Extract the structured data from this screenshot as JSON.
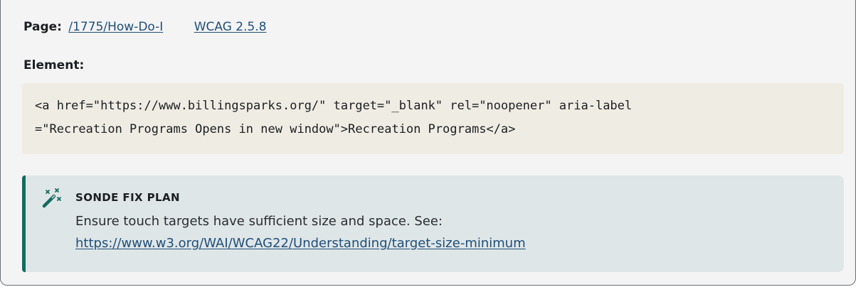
{
  "issue": {
    "page_label": "Page:",
    "page_link": "/1775/How-Do-I",
    "wcag_link": "WCAG 2.5.8",
    "element_label": "Element:",
    "element_code": "<a href=\"https://www.billingsparks.org/\" target=\"_blank\" rel=\"noopener\" aria-label\n=\"Recreation Programs Opens in new window\">Recreation Programs</a>"
  },
  "fix_plan": {
    "icon": "magic-wand-icon",
    "title": "SONDE FIX PLAN",
    "description": "Ensure touch targets have sufficient size and space. See:",
    "link": "https://www.w3.org/WAI/WCAG22/Understanding/target-size-minimum"
  },
  "colors": {
    "link": "#1f4e79",
    "accent": "#146b60",
    "code_bg": "#efece3",
    "fix_bg": "#dfe6e7"
  }
}
